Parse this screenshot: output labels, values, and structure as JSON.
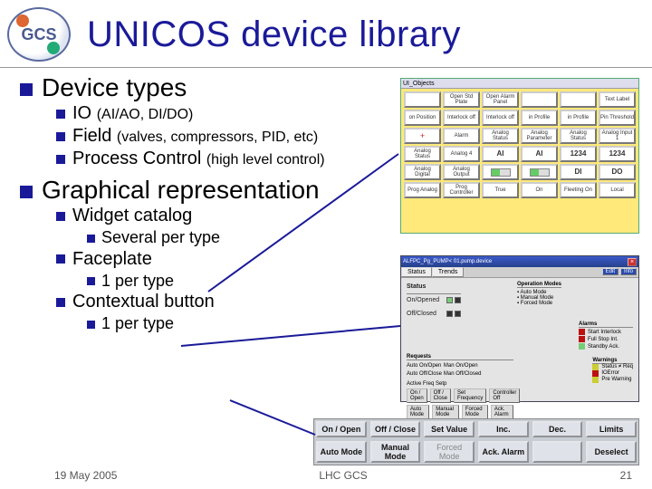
{
  "title": "UNICOS device library",
  "logo_text": "GCS",
  "outline": {
    "s1": {
      "label": "Device types",
      "items": [
        {
          "label": "IO",
          "detail": "(AI/AO, DI/DO)"
        },
        {
          "label": "Field",
          "detail": "(valves, compressors, PID, etc)"
        },
        {
          "label": "Process Control",
          "detail": "(high level control)"
        }
      ]
    },
    "s2": {
      "label": "Graphical representation",
      "items": [
        {
          "label": "Widget catalog",
          "sub": "Several per type"
        },
        {
          "label": "Faceplate",
          "sub": "1 per type"
        },
        {
          "label": "Contextual button",
          "sub": "1 per type"
        }
      ]
    }
  },
  "catalog": {
    "winbar": "UI_Objects",
    "cells": [
      "",
      "Open Std Plate",
      "Open Alarm Panel",
      "",
      "",
      "Text Label",
      "on Position",
      "Interlock off",
      "Interlock off",
      "in Profile",
      "in Profile",
      "Pin Threshold",
      "+",
      "Alarm",
      "Analog Status",
      "Analog Parameter",
      "Analog Status",
      "Analog Input 1",
      "Analog Status",
      "Analog 4",
      "AI",
      "AI",
      "1234",
      "1234",
      "Analog Digital",
      "Analog Output",
      "bar",
      "bar",
      "DI",
      "DO",
      "Prog Analog",
      "Prog Controller",
      "True",
      "On",
      "Fleeting On",
      "Local"
    ]
  },
  "faceplate": {
    "title": "ALFPC_Pg_PUMP< 01.pump.device",
    "tabs": [
      "Status",
      "Trends"
    ],
    "info_buttons": [
      "Edit",
      "Info"
    ],
    "status_label": "Status",
    "status_rows": [
      "On/Opened",
      "Off/Closed"
    ],
    "opmodes": {
      "title": "Operation Modes",
      "items": [
        "Auto Mode",
        "Manual Mode",
        "Forced Mode"
      ]
    },
    "alarms": {
      "title": "Alarms",
      "items": [
        "Start Interlock",
        "Full Stop Int.",
        "Standby Ack."
      ]
    },
    "requests": {
      "title": "Requests",
      "items": [
        "Auto On/Open",
        "Auto Off/Close",
        "Man On/Open",
        "Man Off/Closed"
      ]
    },
    "warnings": {
      "title": "Warnings",
      "items": [
        "Status ≠ Req",
        "IOError",
        "Pre Warning"
      ]
    },
    "buttons": [
      "On / Open",
      "Off / Close",
      "Set Frequency",
      "Controller Off"
    ],
    "mode_row": [
      "Auto Mode",
      "Manual Mode",
      "Forced Mode",
      "Ack. Alarm"
    ],
    "extra": "Active Freq Setp"
  },
  "contextual_buttons": [
    "On / Open",
    "Off / Close",
    "Set Value",
    "Inc.",
    "Dec.",
    "Limits",
    "Auto Mode",
    "Manual Mode",
    "Forced Mode",
    "Ack. Alarm",
    "",
    "Deselect"
  ],
  "footer": {
    "date": "19 May 2005",
    "middle": "LHC GCS",
    "page": "21"
  }
}
